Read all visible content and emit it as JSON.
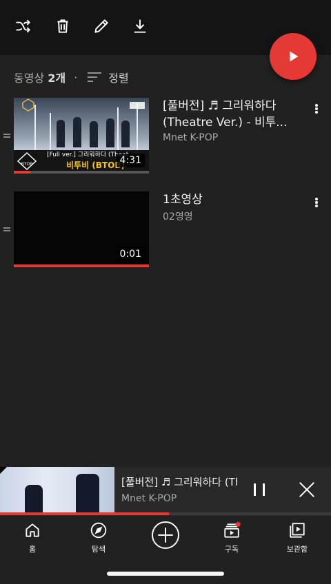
{
  "toolbar": {
    "shuffle_icon": "shuffle-icon",
    "delete_icon": "trash-icon",
    "edit_icon": "pencil-icon",
    "download_icon": "download-icon"
  },
  "play_all_icon": "play-icon",
  "playlist": {
    "count_label": "동영상",
    "count_value": "2개",
    "separator": "·",
    "sort_label": "정렬"
  },
  "videos": [
    {
      "title_line1": "[풀버전] ♬ 그리워하다",
      "title_line2": "(Theatre Ver.) - 비투...",
      "channel": "Mnet K-POP",
      "duration": "4:31",
      "watched_fraction": 0.12,
      "thumb_caption": "[Full ver.] 그리워하다 (Theat",
      "thumb_artist": "비투비 (BTOB)",
      "thumb_logo": "BTOB"
    },
    {
      "title_line1": "1초영상",
      "title_line2": "",
      "channel": "02영영",
      "duration": "0:01",
      "watched_fraction": 1.0
    }
  ],
  "miniplayer": {
    "title": "[풀버전] ♬ 그리워하다 (Th...",
    "channel": "Mnet K-POP",
    "progress_fraction": 0.51
  },
  "nav": [
    {
      "label": "홈",
      "icon": "home-icon"
    },
    {
      "label": "탐색",
      "icon": "compass-icon"
    },
    {
      "label": "",
      "icon": "add-circle-icon"
    },
    {
      "label": "구독",
      "icon": "subscriptions-icon"
    },
    {
      "label": "보관함",
      "icon": "library-icon"
    }
  ],
  "colors": {
    "accent": "#e53935",
    "background": "#212121",
    "topbar": "#141414"
  }
}
